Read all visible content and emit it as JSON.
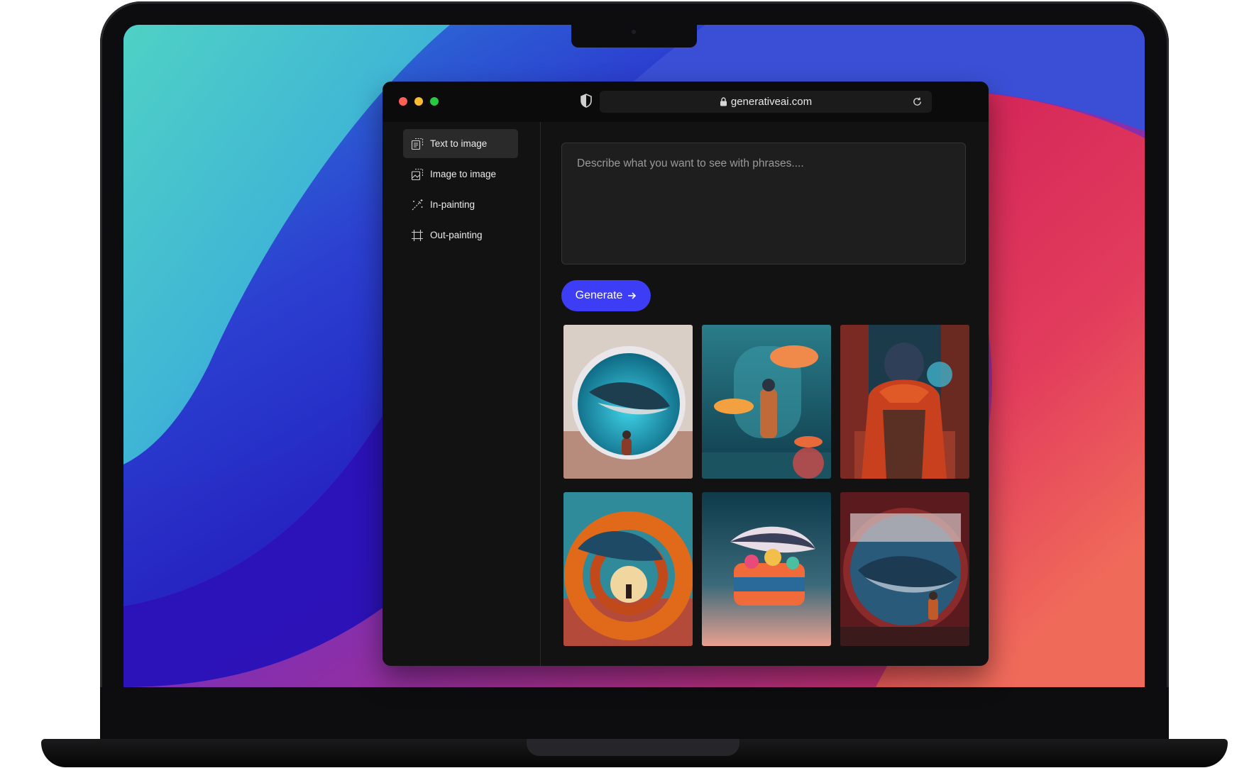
{
  "browser": {
    "url": "generativeai.com"
  },
  "sidebar": {
    "items": [
      {
        "label": "Text to image",
        "icon": "text-image-icon",
        "active": true
      },
      {
        "label": "Image to image",
        "icon": "image-image-icon",
        "active": false
      },
      {
        "label": "In-painting",
        "icon": "magic-wand-icon",
        "active": false
      },
      {
        "label": "Out-painting",
        "icon": "crop-expand-icon",
        "active": false
      }
    ]
  },
  "prompt": {
    "placeholder": "Describe what you want to see with phrases....",
    "value": ""
  },
  "generate": {
    "label": "Generate"
  },
  "gallery": {
    "images": [
      {
        "subject": "whale in porthole with child"
      },
      {
        "subject": "child in aquarium with fish"
      },
      {
        "subject": "child in red jacket at arcade aquarium"
      },
      {
        "subject": "whale in orange rings tunnel"
      },
      {
        "subject": "whale over colorful vehicle"
      },
      {
        "subject": "whale in round window with child"
      }
    ]
  },
  "colors": {
    "accent": "#3d3df5",
    "window_bg": "#121212",
    "sidebar_active": "#2a2a2a"
  }
}
